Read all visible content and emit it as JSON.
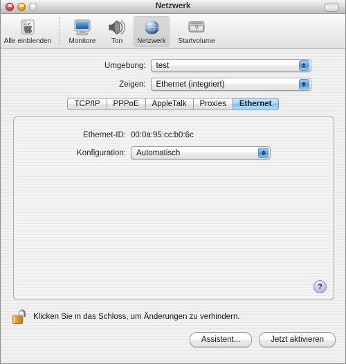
{
  "window": {
    "title": "Netzwerk",
    "close_label": "",
    "minimize_label": "",
    "zoom_label": ""
  },
  "toolbar": {
    "items": [
      {
        "label": "Alle einblenden",
        "icon": "show-all-icon",
        "selected": false
      },
      {
        "label": "Monitore",
        "icon": "displays-icon",
        "selected": false
      },
      {
        "label": "Ton",
        "icon": "sound-icon",
        "selected": false
      },
      {
        "label": "Netzwerk",
        "icon": "network-globe-icon",
        "selected": true
      },
      {
        "label": "Startvolume",
        "icon": "startup-disk-icon",
        "selected": false
      }
    ]
  },
  "form": {
    "location": {
      "label": "Umgebung:",
      "value": "test"
    },
    "show": {
      "label": "Zeigen:",
      "value": "Ethernet (integriert)"
    }
  },
  "tabs": [
    {
      "label": "TCP/IP",
      "active": false
    },
    {
      "label": "PPPoE",
      "active": false
    },
    {
      "label": "AppleTalk",
      "active": false
    },
    {
      "label": "Proxies",
      "active": false
    },
    {
      "label": "Ethernet",
      "active": true
    }
  ],
  "panel": {
    "ethernet_id": {
      "label": "Ethernet-ID:",
      "value": "00:0a:95:cc:b0:6c"
    },
    "configuration": {
      "label": "Konfiguration:",
      "value": "Automatisch"
    },
    "help_label": "?"
  },
  "lock": {
    "icon": "unlocked-padlock-icon",
    "text": "Klicken Sie in das Schloss, um Änderungen zu verhindern."
  },
  "buttons": {
    "assistant": "Assistent...",
    "apply": "Jetzt aktivieren"
  },
  "colors": {
    "accent_tab": "#8bbfea",
    "popup_arrow": "#4b95db",
    "help_button": "#b9a3d8",
    "lock_body": "#e2922f"
  }
}
